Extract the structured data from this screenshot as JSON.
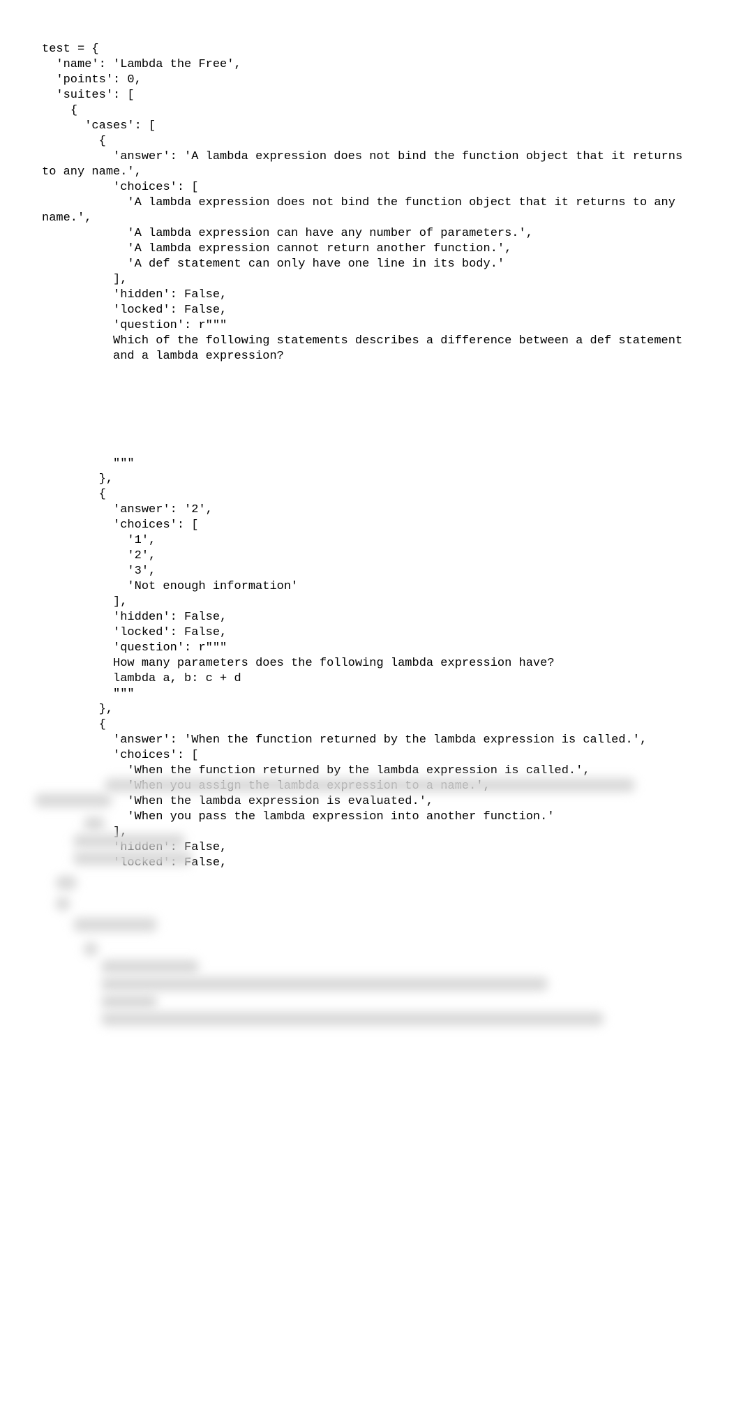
{
  "code_lines": [
    "test = {",
    "  'name': 'Lambda the Free',",
    "  'points': 0,",
    "  'suites': [",
    "    {",
    "      'cases': [",
    "        {",
    "          'answer': 'A lambda expression does not bind the function object that it returns to any name.',",
    "          'choices': [",
    "            'A lambda expression does not bind the function object that it returns to any name.',",
    "            'A lambda expression can have any number of parameters.',",
    "            'A lambda expression cannot return another function.',",
    "            'A def statement can only have one line in its body.'",
    "          ],",
    "          'hidden': False,",
    "          'locked': False,",
    "          'question': r\"\"\"",
    "          Which of the following statements describes a difference between a def statement",
    "          and a lambda expression?",
    "",
    "",
    "",
    "",
    "",
    "",
    "          \"\"\"",
    "        },",
    "        {",
    "          'answer': '2',",
    "          'choices': [",
    "            '1',",
    "            '2',",
    "            '3',",
    "            'Not enough information'",
    "          ],",
    "          'hidden': False,",
    "          'locked': False,",
    "          'question': r\"\"\"",
    "          How many parameters does the following lambda expression have?",
    "          lambda a, b: c + d",
    "          \"\"\"",
    "        },",
    "        {",
    "          'answer': 'When the function returned by the lambda expression is called.',",
    "          'choices': [",
    "            'When the function returned by the lambda expression is called.',",
    "            'When you assign the lambda expression to a name.',",
    "            'When the lambda expression is evaluated.',",
    "            'When you pass the lambda expression into another function.'",
    "          ],",
    "          'hidden': False,",
    "          'locked': False,"
  ],
  "blurred_hint_lines": [
    "          'question': 'When is the return expression of a lambda expression executed?'",
    "        }",
    "      ],",
    "      'scored': False,",
    "      'type': 'concept'",
    "    },",
    "    {",
    "      'cases': [",
    "        {",
    "          'code': r\"\"\"",
    "          >>> lambda x: x  # A lambda expression with one parameter x",
    "          ______",
    "          >>> a = lambda x: x  # Assigning a lambda function to the name a"
  ]
}
